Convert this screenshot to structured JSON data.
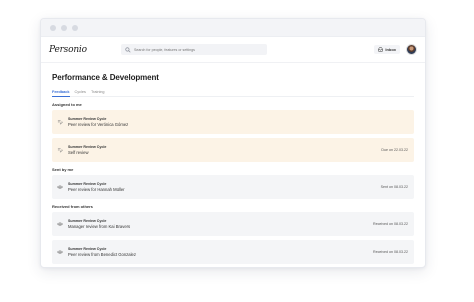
{
  "app": {
    "logo_text": "Personio",
    "search_placeholder": "Search for people, features or settings",
    "inbox_label": "Inbox"
  },
  "page": {
    "title": "Performance & Development",
    "tabs": [
      {
        "label": "Feedback",
        "active": true
      },
      {
        "label": "Cycles",
        "active": false
      },
      {
        "label": "Training",
        "active": false
      }
    ]
  },
  "sections": {
    "assigned": {
      "title": "Assigned to me",
      "items": [
        {
          "cycle": "Summer Review Cycle",
          "description": "Peer review for Verónica Gómez",
          "date": "",
          "status": "pending",
          "icon": "edit-icon"
        },
        {
          "cycle": "Summer Review Cycle",
          "description": "Self review",
          "date": "Due on 22.03.22",
          "status": "pending",
          "icon": "edit-icon"
        }
      ]
    },
    "sent": {
      "title": "Sent by me",
      "items": [
        {
          "cycle": "Summer Review Cycle",
          "description": "Peer review for Hannah Müller",
          "date": "Sent on 08.03.22",
          "status": "done",
          "icon": "eye-icon"
        }
      ]
    },
    "received": {
      "title": "Received from others",
      "items": [
        {
          "cycle": "Summer Review Cycle",
          "description": "Manager review from Kai Bravers",
          "date": "Received on 08.03.22",
          "status": "done",
          "icon": "eye-icon"
        },
        {
          "cycle": "Summer Review Cycle",
          "description": "Peer review from Benedict Gonzalez",
          "date": "Received on 08.03.22",
          "status": "done",
          "icon": "eye-icon"
        }
      ]
    }
  },
  "colors": {
    "pending_bg": "#fcf3e6",
    "done_bg": "#f4f5f7",
    "accent": "#3a6fd6"
  }
}
